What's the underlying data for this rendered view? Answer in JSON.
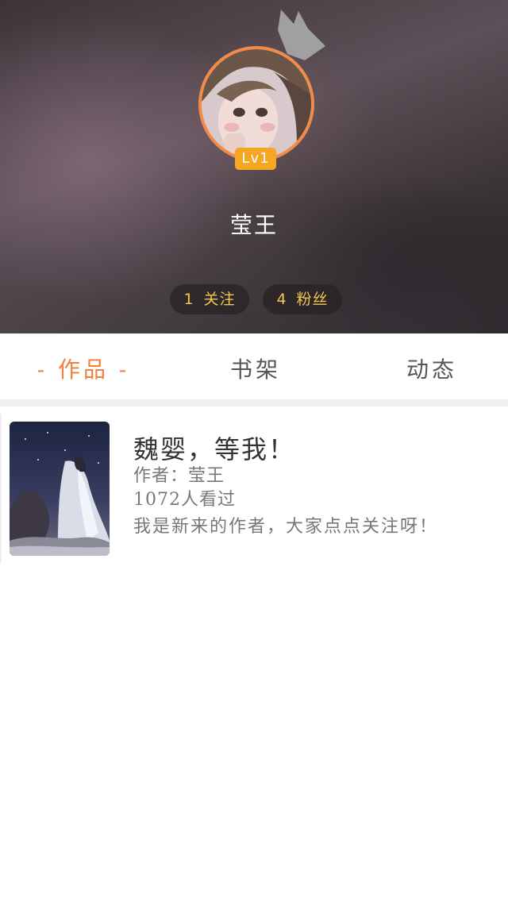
{
  "profile": {
    "level": "Lv1",
    "username": "莹王",
    "following": {
      "count": "1",
      "label": "关注"
    },
    "fans": {
      "count": "4",
      "label": "粉丝"
    }
  },
  "tabs": [
    {
      "label": "- 作品 -",
      "active": true
    },
    {
      "label": "书架",
      "active": false
    },
    {
      "label": "动态",
      "active": false
    }
  ],
  "works": [
    {
      "title": "魏婴，等我！",
      "author": "作者：莹王",
      "views": "1072人看过",
      "description": "我是新来的作者，大家点点关注呀！"
    }
  ],
  "colors": {
    "accent": "#f0803c",
    "avatar_border": "#f28b48",
    "level_badge": "#f5a623",
    "stat_text": "#f2c94c"
  },
  "icons": {
    "crown": "crown-icon"
  }
}
